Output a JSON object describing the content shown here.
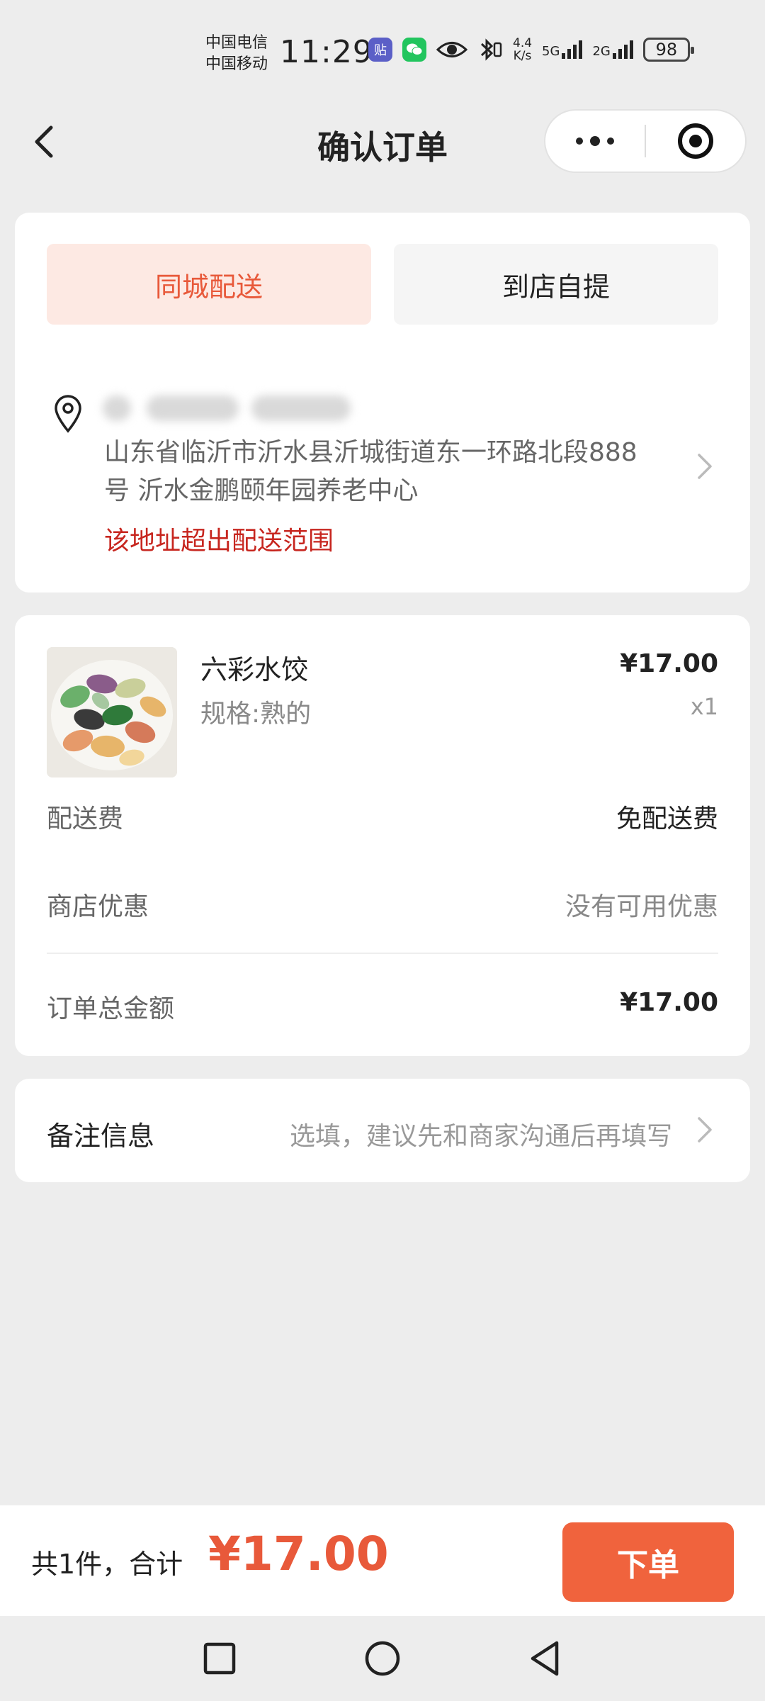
{
  "status_bar": {
    "carrier_1": "中国电信",
    "carrier_2": "中国移动",
    "time": "11:29",
    "app_badge_1": "贴",
    "net_speed_value": "4.4",
    "net_speed_unit": "K/s",
    "network_1": "5G",
    "network_2": "2G",
    "battery": "98"
  },
  "nav": {
    "title": "确认订单"
  },
  "delivery": {
    "tabs": [
      {
        "label": "同城配送",
        "active": true
      },
      {
        "label": "到店自提",
        "active": false
      }
    ],
    "address_line": "山东省临沂市沂水县沂城街道东一环路北段888号 沂水金鹏颐年园养老中心",
    "warning": "该地址超出配送范围"
  },
  "order": {
    "product": {
      "name": "六彩水饺",
      "spec": "规格:熟的",
      "price": "¥17.00",
      "quantity": "x1"
    },
    "rows": {
      "shipping_label": "配送费",
      "shipping_value": "免配送费",
      "discount_label": "商店优惠",
      "discount_value": "没有可用优惠",
      "total_label": "订单总金额",
      "total_value": "¥17.00"
    }
  },
  "remark": {
    "label": "备注信息",
    "placeholder": "选填，建议先和商家沟通后再填写"
  },
  "bottom_bar": {
    "summary": "共1件，合计",
    "amount": "¥17.00",
    "submit_label": "下单"
  },
  "colors": {
    "accent": "#f0633d",
    "accent_text": "#e8593a",
    "warning": "#c7261f",
    "page_bg": "#ededed"
  }
}
